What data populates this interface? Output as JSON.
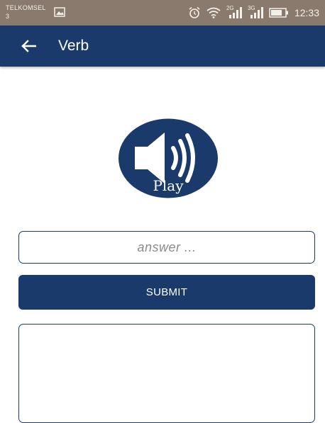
{
  "status_bar": {
    "carrier": "TELKOMSEL",
    "sim_slot": "3",
    "network_1": "2G",
    "network_2": "3G",
    "time": "12:33"
  },
  "app_bar": {
    "title": "Verb"
  },
  "play": {
    "label": "Play"
  },
  "answer": {
    "placeholder": "answer ...",
    "value": ""
  },
  "submit": {
    "label": "SUBMIT"
  },
  "result": {
    "text": ""
  },
  "colors": {
    "primary": "#1a3a6b",
    "status_bar": "#8a7a6d",
    "background": "#ffffff"
  }
}
